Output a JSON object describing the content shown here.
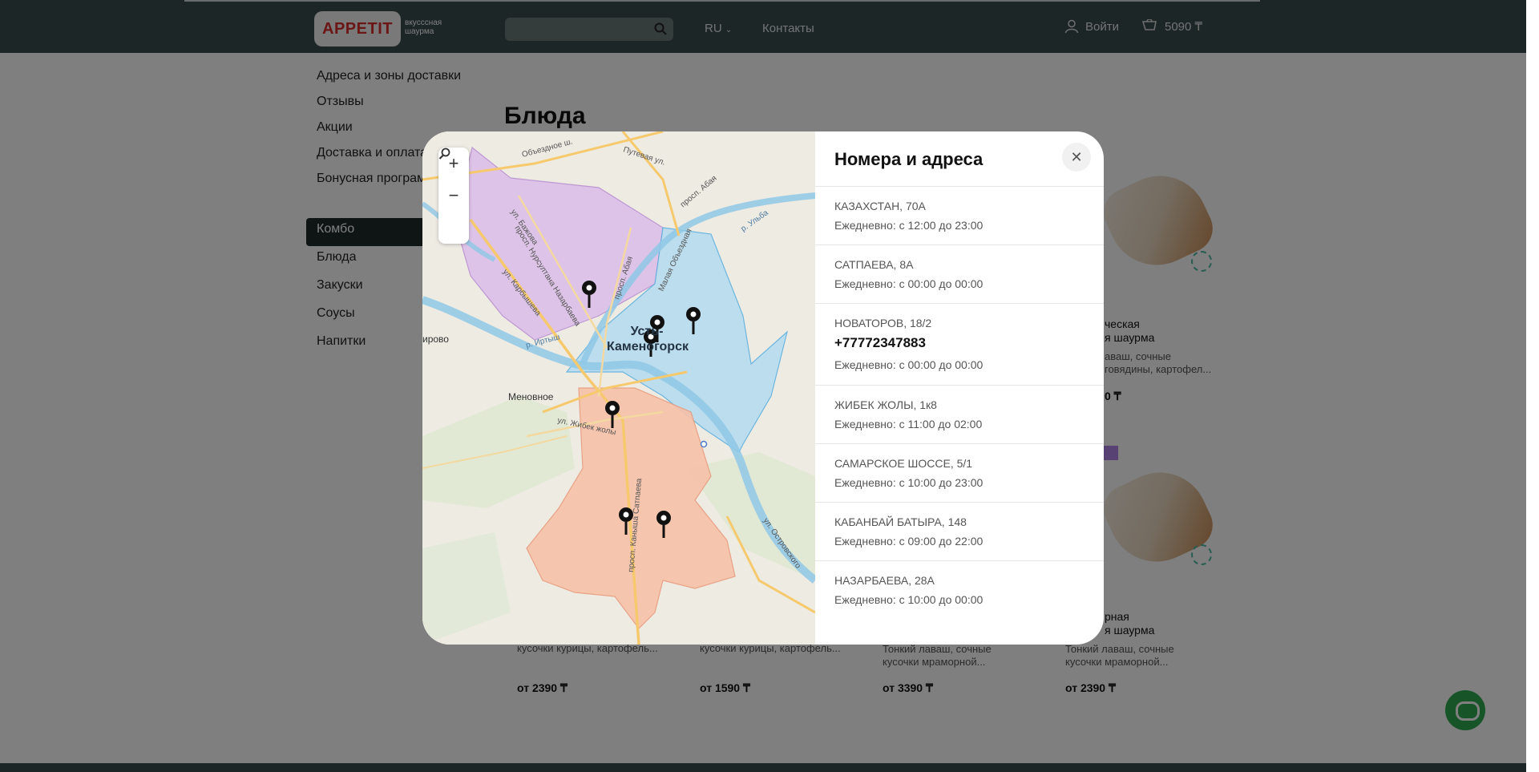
{
  "header": {
    "logo_text": "APPETIT",
    "logo_tagline": "вкусссная шаурма",
    "lang": "RU",
    "contacts": "Контакты",
    "login": "Войти",
    "cart_total": "5090 ₸"
  },
  "sidebar": {
    "links": [
      "Адреса и зоны доставки",
      "Отзывы",
      "Акции",
      "Доставка и оплата",
      "Бонусная программа"
    ],
    "categories": [
      "Комбо",
      "Блюда",
      "Закуски",
      "Соусы",
      "Напитки"
    ]
  },
  "main": {
    "title": "Блюда",
    "card_partial_1": "ческая",
    "card_partial_2": "я шаурма",
    "card_partial_3": "аваш, сочные",
    "card_partial_4": "говядины, картофел...",
    "card_partial_price": "0 ₸",
    "card_partial_5": "рная",
    "card_partial_6": "я шаурма",
    "desc_a": "кусочки курицы, картофель...",
    "desc_b": "кусочки курицы, картофель...",
    "desc_c1": "Тонкий лаваш, сочные",
    "desc_c2": "кусочки мраморной...",
    "desc_d1": "Тонкий лаваш, сочные",
    "desc_d2": "кусочки мраморной...",
    "prices": [
      "от 2390 ₸",
      "от 1590 ₸",
      "от 3390 ₸",
      "от 2390 ₸"
    ]
  },
  "modal": {
    "title": "Номера и адреса",
    "close_icon": "close-icon",
    "map": {
      "city_label_1": "Усть-",
      "city_label_2": "Каменогорск",
      "village_1": "Меновное",
      "village_2": "ирово",
      "streets": [
        "Объездное ш.",
        "Путевая ул.",
        "просп. Абая",
        "ул. Бажова",
        "просп. Нурсултана Назарбаева",
        "ул. Карбышева",
        "просп. Абая",
        "Малая Объездная",
        "р. Ульба",
        "р. Иртыш",
        "ул. Жибек жолы",
        "просп. Каныша Сатпаева",
        "ул. Островского"
      ],
      "zoom_in": "+",
      "zoom_out": "−"
    },
    "locations": [
      {
        "address": "КАЗАХСТАН, 70А",
        "phone": "",
        "hours": "Ежедневно: с 12:00 до 23:00"
      },
      {
        "address": "САТПАЕВА, 8А",
        "phone": "",
        "hours": "Ежедневно: с 00:00 до 00:00"
      },
      {
        "address": "НОВАТОРОВ, 18/2",
        "phone": "+77772347883",
        "hours": "Ежедневно: с 00:00 до 00:00"
      },
      {
        "address": "ЖИБЕК ЖОЛЫ, 1к8",
        "phone": "",
        "hours": "Ежедневно: с 11:00 до 02:00"
      },
      {
        "address": "САМАРСКОЕ ШОССЕ, 5/1",
        "phone": "",
        "hours": "Ежедневно: с 10:00 до 23:00"
      },
      {
        "address": "КАБАНБАЙ БАТЫРА, 148",
        "phone": "",
        "hours": "Ежедневно: с 09:00 до 22:00"
      },
      {
        "address": "НАЗАРБАЕВА, 28А",
        "phone": "",
        "hours": "Ежедневно: с 10:00 до 00:00"
      }
    ]
  },
  "colors": {
    "header_bg": "#3a4c4f",
    "zone_purple": "#d9b8e6",
    "zone_blue": "#a9d8f0",
    "zone_orange": "#f7b79c"
  }
}
